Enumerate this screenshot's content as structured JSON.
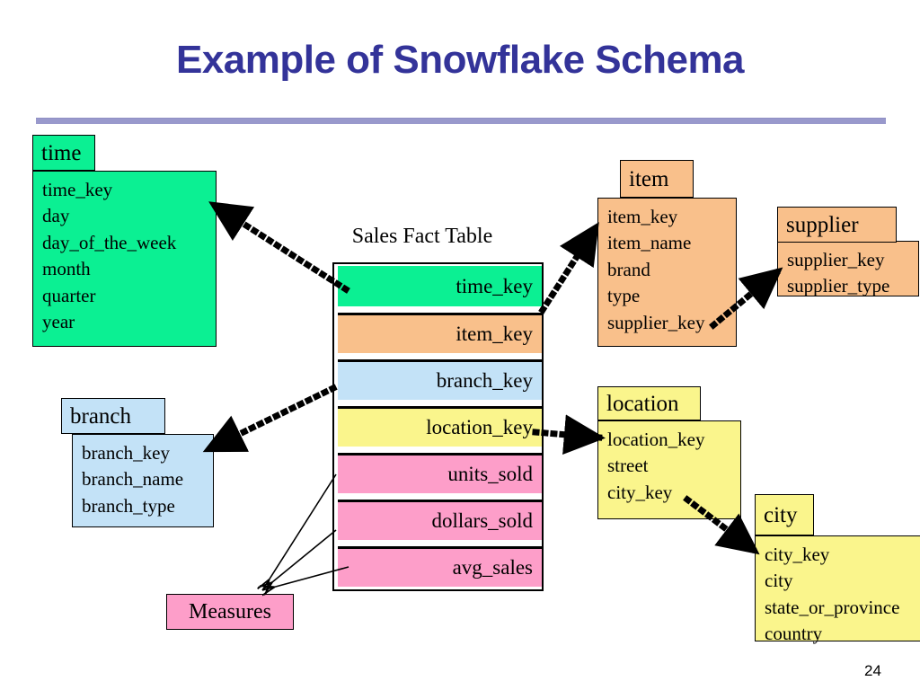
{
  "slide": {
    "title": "Example of Snowflake Schema",
    "page_number": "24"
  },
  "colors": {
    "title": "#333399",
    "rule": "#9999cc",
    "green": "#0bf093",
    "orange": "#f9c08b",
    "blue": "#c3e2f7",
    "yellow": "#faf58c",
    "pink": "#fd9ec9"
  },
  "fact_table": {
    "caption": "Sales Fact Table",
    "rows": [
      {
        "label": "time_key",
        "color": "#0bf093"
      },
      {
        "label": "item_key",
        "color": "#f9c08b"
      },
      {
        "label": "branch_key",
        "color": "#c3e2f7"
      },
      {
        "label": "location_key",
        "color": "#faf58c"
      },
      {
        "label": "units_sold",
        "color": "#fd9ec9"
      },
      {
        "label": "dollars_sold",
        "color": "#fd9ec9"
      },
      {
        "label": "avg_sales",
        "color": "#fd9ec9"
      }
    ]
  },
  "measures": {
    "label": "Measures"
  },
  "dimensions": {
    "time": {
      "title": "time",
      "fields": [
        "time_key",
        "day",
        "day_of_the_week",
        "month",
        "quarter",
        "year"
      ]
    },
    "branch": {
      "title": "branch",
      "fields": [
        "branch_key",
        "branch_name",
        "branch_type"
      ]
    },
    "item": {
      "title": "item",
      "fields": [
        "item_key",
        "item_name",
        "brand",
        "type",
        "supplier_key"
      ]
    },
    "supplier": {
      "title": "supplier",
      "fields": [
        "supplier_key",
        "supplier_type"
      ]
    },
    "location": {
      "title": "location",
      "fields": [
        "location_key",
        "street",
        "city_key"
      ]
    },
    "city": {
      "title": "city",
      "fields": [
        "city_key",
        "city",
        "state_or_province",
        "country"
      ]
    }
  }
}
